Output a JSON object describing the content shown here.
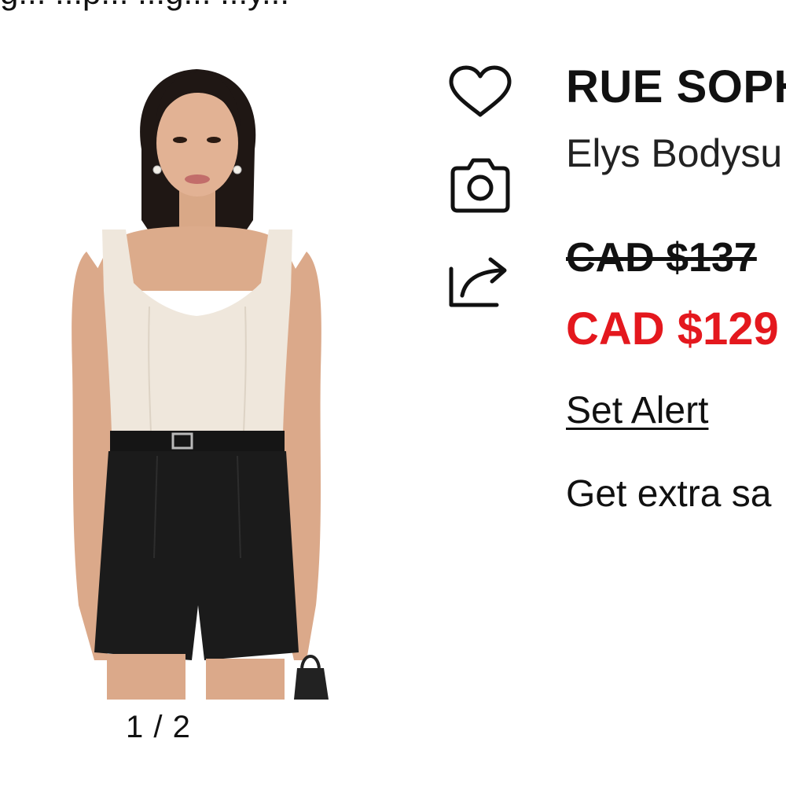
{
  "top_banner": {
    "text": "g... ...p... ...g... ...y..."
  },
  "gallery": {
    "image_alt": "Model wearing cream sweetheart-neck bodysuit with black belted shorts",
    "counter": "1 / 2"
  },
  "actions": {
    "wishlist_icon": "heart-icon",
    "camera_icon": "camera-icon",
    "share_icon": "share-icon"
  },
  "product": {
    "brand": "RUE SOPH",
    "name": "Elys Bodysu",
    "original_price": "CAD $137",
    "sale_price": "CAD $129",
    "set_alert_label": "Set Alert",
    "extra_savings_text": "Get extra sa"
  },
  "colors": {
    "sale_red": "#e4181e",
    "text": "#111111",
    "background": "#ffffff"
  }
}
